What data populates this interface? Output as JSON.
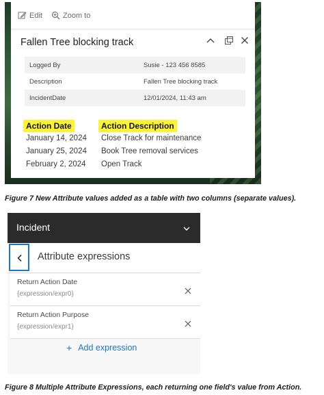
{
  "figure7": {
    "toolbar": {
      "edit_label": "Edit",
      "zoom_label": "Zoom to"
    },
    "popup_title": "Fallen Tree blocking track",
    "attributes": [
      {
        "field": "Logged By",
        "value": "Susie - 123 456 8585"
      },
      {
        "field": "Description",
        "value": "Fallen Tree blocking track"
      },
      {
        "field": "IncidentDate",
        "value": "12/01/2024, 11:43 am"
      }
    ],
    "action_table": {
      "headers": {
        "date": "Action Date",
        "description": "Action Description"
      },
      "rows": [
        {
          "date": "January 14, 2024",
          "description": "Close Track for maintenance"
        },
        {
          "date": "January 25, 2024",
          "description": "Book Tree removal services"
        },
        {
          "date": "February 2, 2024",
          "description": "Open Track"
        }
      ]
    },
    "highlight_color": "#fdf335"
  },
  "caption7": "Figure 7  New Attribute values added as a table with two columns (separate values).",
  "figure8": {
    "panel_title": "Incident",
    "subpanel_title": "Attribute expressions",
    "expressions": [
      {
        "name": "Return Action Date",
        "path": "{expression/expr0}"
      },
      {
        "name": "Return Action Purpose",
        "path": "{expression/expr1}"
      }
    ],
    "add_label": "Add expression",
    "accent_color": "#1b77c7"
  },
  "caption8": "Figure 8 Multiple Attribute Expressions, each returning one field's value from Action."
}
